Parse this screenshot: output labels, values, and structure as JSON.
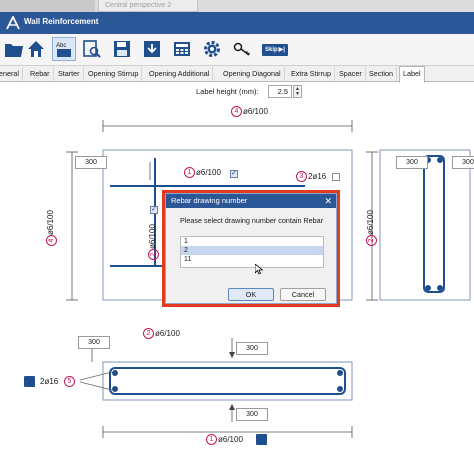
{
  "top_strip": {
    "ghost_tab": "Central perspective 2"
  },
  "window": {
    "title": "Wall Reinforcement"
  },
  "toolbar": {
    "skip_label": "Skip",
    "abc_label": "Abc"
  },
  "tabs": [
    {
      "label": "eneral"
    },
    {
      "label": "Rebar"
    },
    {
      "label": "Starter"
    },
    {
      "label": "Opening Stirrup"
    },
    {
      "label": "Opening Additional"
    },
    {
      "label": "Opening Diagonal"
    },
    {
      "label": "Extra Stirrup"
    },
    {
      "label": "Spacer"
    },
    {
      "label": "Section"
    },
    {
      "label": "Label"
    }
  ],
  "label_height": {
    "label": "Label height (mm):",
    "value": "2.5"
  },
  "drawing": {
    "top_mark": "4",
    "top_label": "ø6/100",
    "dim_top_left": "300",
    "mark1_top": "1",
    "mark1_top_label": "ø6/100",
    "mark3": "3",
    "mark3_label": "2ø16",
    "left_mark": "4",
    "left_label": "ø6/100",
    "inner_mark": "2",
    "inner_label": "ø6/100",
    "right_mark": "2",
    "right_label": "ø6/100",
    "dim_right_top": "300",
    "dim_right_side": "300",
    "section_mark2": "2",
    "section_label2": "ø6/100",
    "dim_section_left": "300",
    "dim_section_right": "300",
    "mark5": "5",
    "mark5_label": "2ø16",
    "dim_bottom": "300",
    "bottom_mark1": "1",
    "bottom_label1": "ø6/100"
  },
  "dialog": {
    "title": "Rebar drawing number",
    "prompt": "Please select drawing number contain Rebar",
    "items": [
      "1",
      "2",
      "11"
    ],
    "selected": "2",
    "ok_label": "OK",
    "cancel_label": "Cancel"
  },
  "colors": {
    "title_bar": "#2b5797",
    "highlight_frame": "#e33a1f",
    "rebar": "#1f4f8f",
    "mark": "#c2185b"
  }
}
